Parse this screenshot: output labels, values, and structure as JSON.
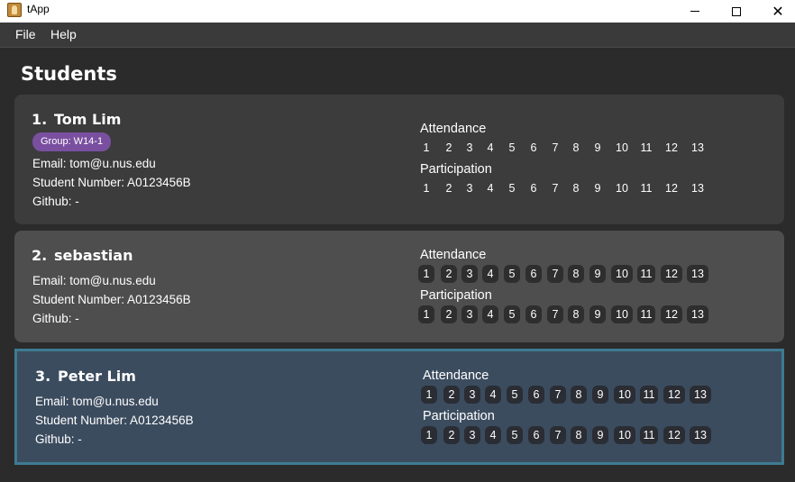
{
  "window": {
    "title": "tApp"
  },
  "menu": {
    "file": "File",
    "help": "Help"
  },
  "page": {
    "title": "Students"
  },
  "students": [
    {
      "index": "1.",
      "name": "Tom Lim",
      "group": "Group: W14-1",
      "email": "Email: tom@u.nus.edu",
      "student_number": "Student Number: A0123456B",
      "github": "Github: -",
      "attendance_label": "Attendance",
      "participation_label": "Participation"
    },
    {
      "index": "2.",
      "name": "sebastian",
      "email": "Email: tom@u.nus.edu",
      "student_number": "Student Number: A0123456B",
      "github": "Github: -",
      "attendance_label": "Attendance",
      "participation_label": "Participation"
    },
    {
      "index": "3.",
      "name": "Peter Lim",
      "email": "Email: tom@u.nus.edu",
      "student_number": "Student Number: A0123456B",
      "github": "Github: -",
      "attendance_label": "Attendance",
      "participation_label": "Participation"
    }
  ],
  "weeks": [
    "1",
    "2",
    "3",
    "4",
    "5",
    "6",
    "7",
    "8",
    "9",
    "10",
    "11",
    "12",
    "13"
  ],
  "colors": {
    "background": "#2b2b2b",
    "card": "#3c3c3c",
    "card_highlighted": "#4e4e4e",
    "card_selected": "#3c4c5f",
    "selected_border": "#3e7b91",
    "group_tag": "#7a4fa0"
  }
}
